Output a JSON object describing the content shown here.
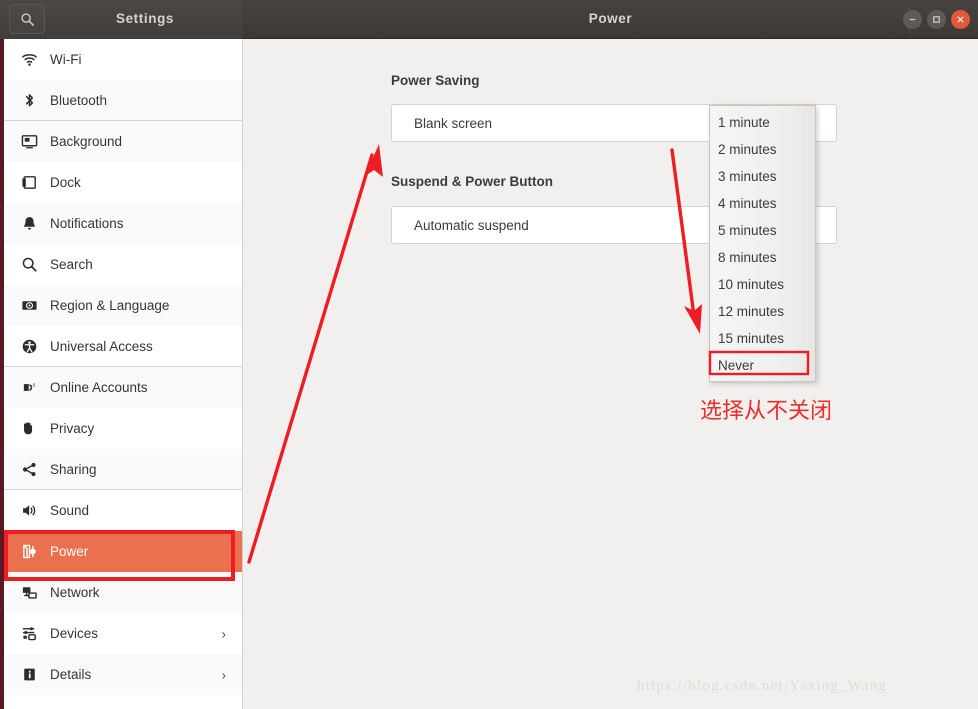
{
  "window": {
    "settings_title": "Settings",
    "page_title": "Power",
    "search_icon": "search-icon",
    "minimize_label": "–",
    "maximize_label": "□",
    "close_label": "✕"
  },
  "sidebar": {
    "items": [
      {
        "label": "Wi-Fi",
        "icon": "wifi-icon"
      },
      {
        "label": "Bluetooth",
        "icon": "bluetooth-icon"
      },
      {
        "label": "Background",
        "icon": "background-icon"
      },
      {
        "label": "Dock",
        "icon": "dock-icon"
      },
      {
        "label": "Notifications",
        "icon": "bell-icon"
      },
      {
        "label": "Search",
        "icon": "search-icon"
      },
      {
        "label": "Region & Language",
        "icon": "region-language-icon"
      },
      {
        "label": "Universal Access",
        "icon": "universal-access-icon"
      },
      {
        "label": "Online Accounts",
        "icon": "online-accounts-icon"
      },
      {
        "label": "Privacy",
        "icon": "privacy-hand-icon"
      },
      {
        "label": "Sharing",
        "icon": "sharing-icon"
      },
      {
        "label": "Sound",
        "icon": "sound-speaker-icon"
      },
      {
        "label": "Power",
        "icon": "power-plug-icon"
      },
      {
        "label": "Network",
        "icon": "network-icon"
      },
      {
        "label": "Devices",
        "icon": "devices-icon",
        "chevron": "›"
      },
      {
        "label": "Details",
        "icon": "details-info-icon",
        "chevron": "›"
      }
    ],
    "selected": "Power"
  },
  "main": {
    "power_saving_heading": "Power Saving",
    "blank_screen_label": "Blank screen",
    "suspend_heading": "Suspend & Power Button",
    "automatic_suspend_label": "Automatic suspend"
  },
  "dropdown": {
    "options": [
      "1 minute",
      "2 minutes",
      "3 minutes",
      "4 minutes",
      "5 minutes",
      "8 minutes",
      "10 minutes",
      "12 minutes",
      "15 minutes",
      "Never"
    ],
    "highlighted": "Never"
  },
  "annotations": {
    "note_text": "选择从不关闭",
    "watermark": "https://blog.csdn.net/Yaxing_Wang",
    "accent_red": "#ef2c2c",
    "selected_orange": "#ea7050"
  }
}
